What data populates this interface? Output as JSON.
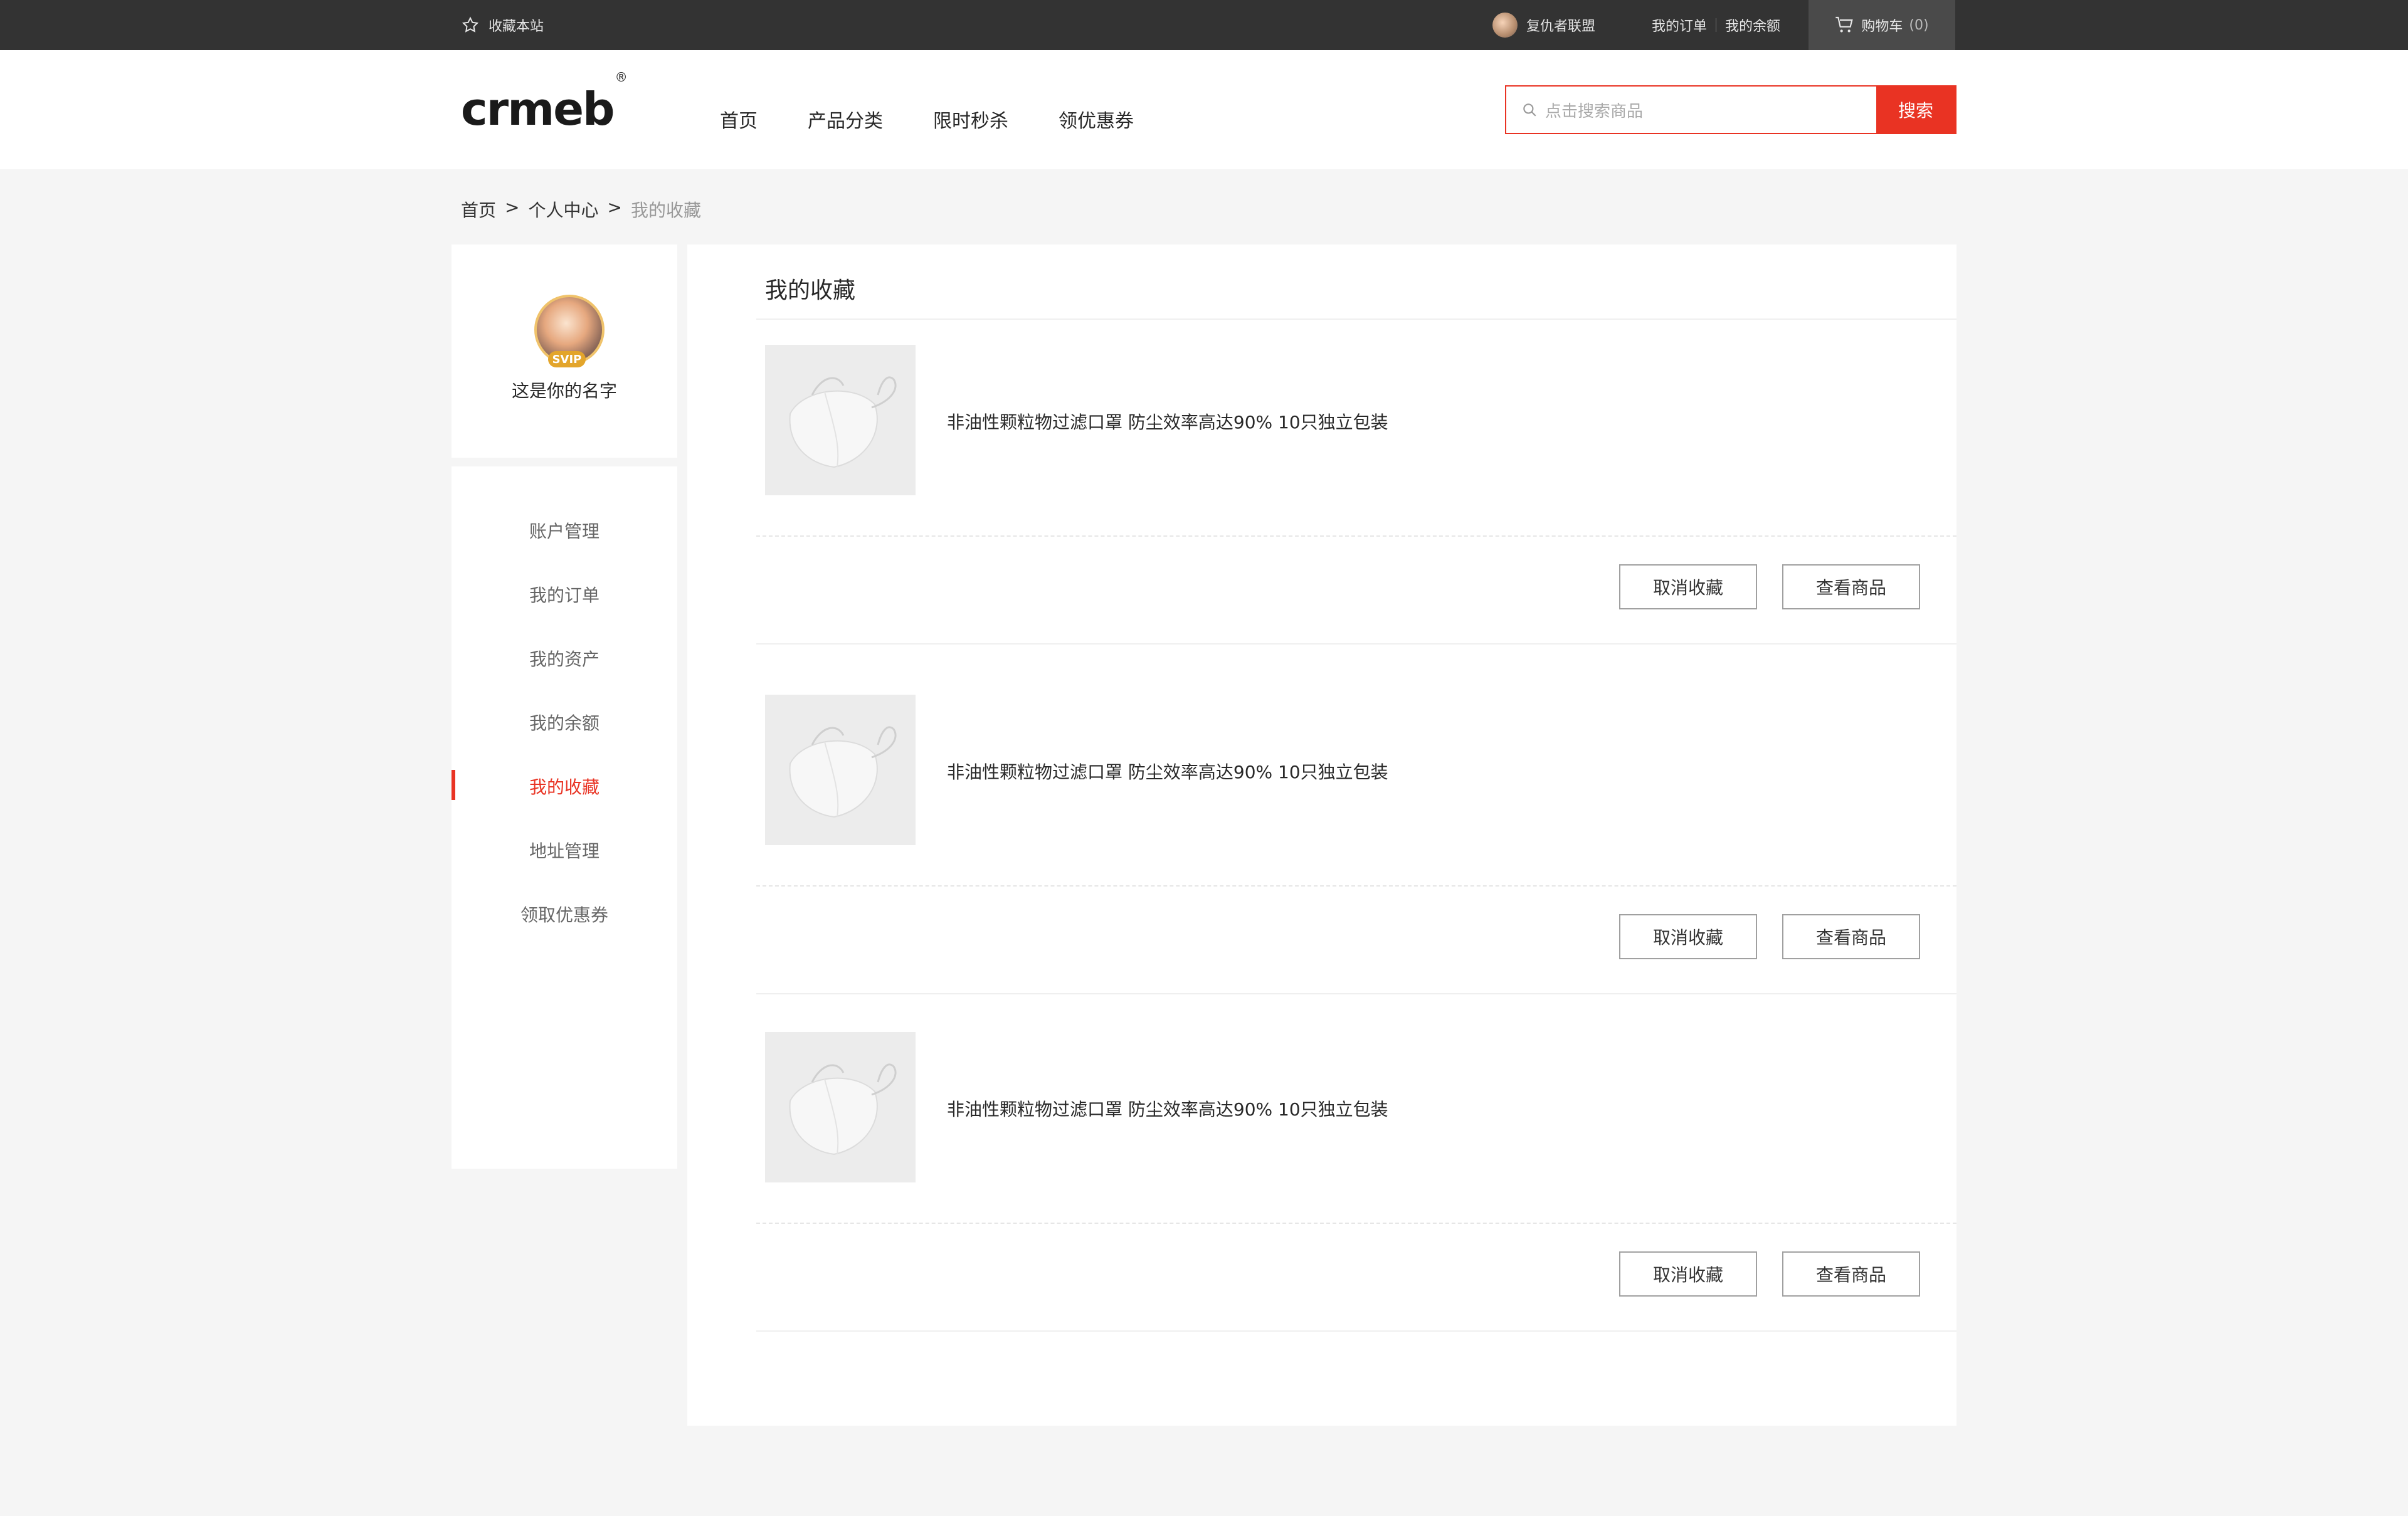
{
  "topbar": {
    "favorite_label": "收藏本站",
    "username": "复仇者联盟",
    "links": [
      "我的订单",
      "我的余额"
    ],
    "cart_label": "购物车",
    "cart_count": "(0)"
  },
  "header": {
    "logo": "crmeb",
    "nav": [
      "首页",
      "产品分类",
      "限时秒杀",
      "领优惠券"
    ],
    "search_placeholder": "点击搜索商品",
    "search_button": "搜索"
  },
  "breadcrumb": {
    "items": [
      "首页",
      ">",
      "个人中心",
      ">"
    ],
    "current": "我的收藏"
  },
  "sidebar": {
    "user_name": "这是你的名字",
    "badge": "SVIP",
    "menu": [
      "账户管理",
      "我的订单",
      "我的资产",
      "我的余额",
      "我的收藏",
      "地址管理",
      "领取优惠券"
    ],
    "active_index": 4
  },
  "content": {
    "title": "我的收藏",
    "items": [
      {
        "name": "非油性颗粒物过滤口罩  防尘效率高达90% 10只独立包装",
        "cancel_label": "取消收藏",
        "view_label": "查看商品"
      },
      {
        "name": "非油性颗粒物过滤口罩  防尘效率高达90% 10只独立包装",
        "cancel_label": "取消收藏",
        "view_label": "查看商品"
      },
      {
        "name": "非油性颗粒物过滤口罩  防尘效率高达90% 10只独立包装",
        "cancel_label": "取消收藏",
        "view_label": "查看商品"
      }
    ]
  },
  "colors": {
    "accent": "#e93323",
    "topbar_bg": "#333333",
    "page_bg": "#f5f5f5"
  }
}
